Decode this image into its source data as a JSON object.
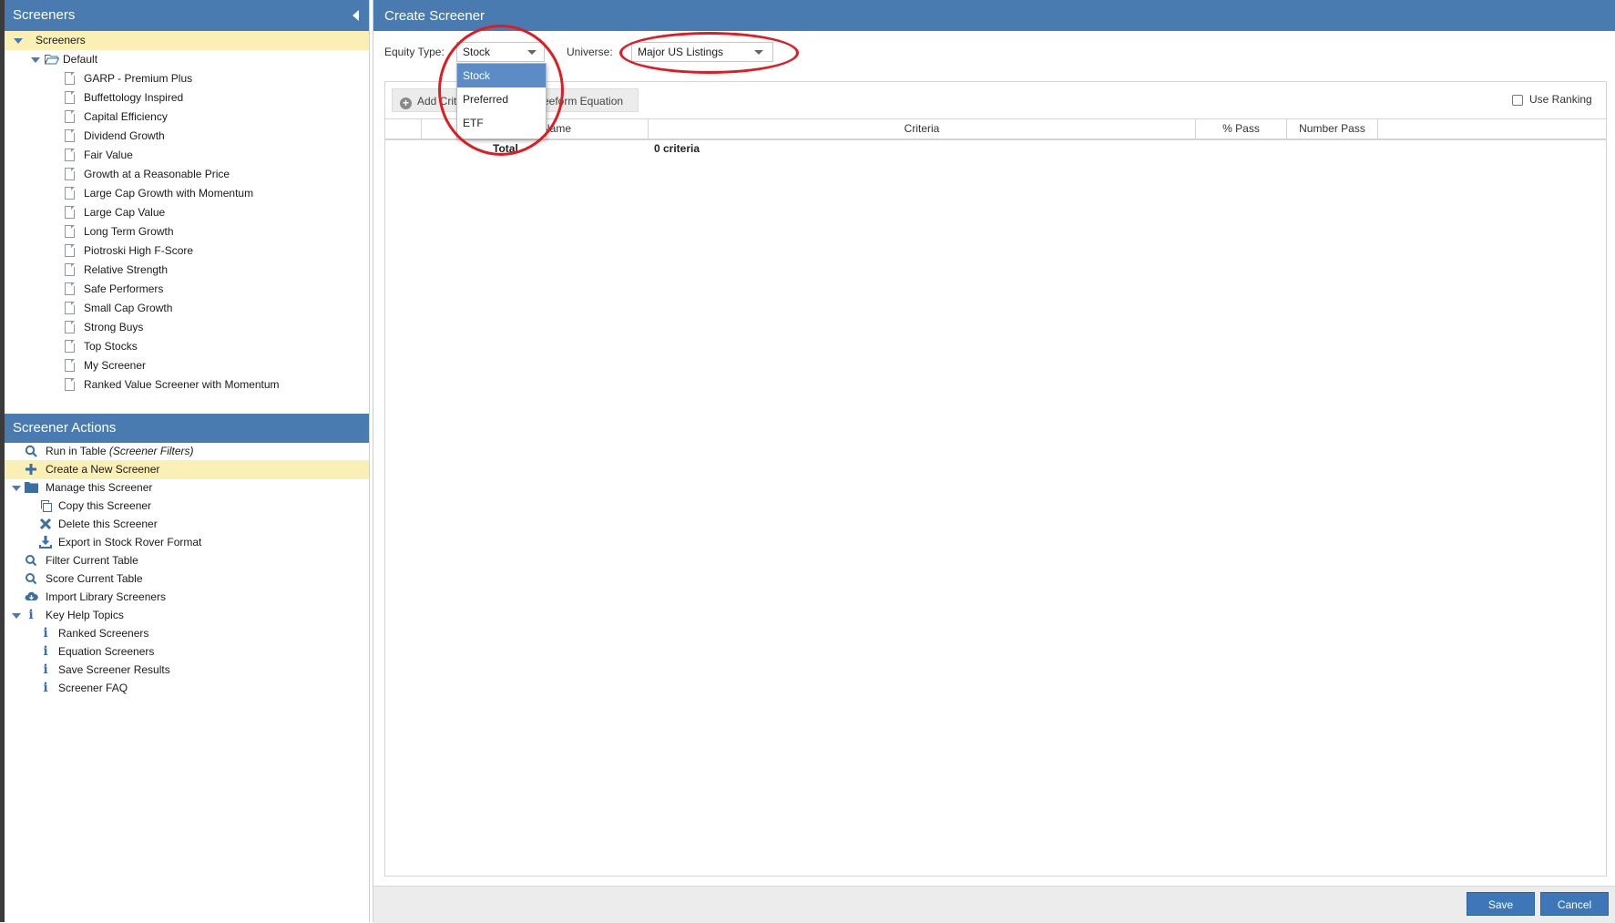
{
  "sidebar": {
    "screeners_header": "Screeners",
    "tree_root": "Screeners",
    "folder": "Default",
    "items": [
      "GARP - Premium Plus",
      "Buffettology Inspired",
      "Capital Efficiency",
      "Dividend Growth",
      "Fair Value",
      "Growth at a Reasonable Price",
      "Large Cap Growth with Momentum",
      "Large Cap Value",
      "Long Term Growth",
      "Piotroski High F-Score",
      "Relative Strength",
      "Safe Performers",
      "Small Cap Growth",
      "Strong Buys",
      "Top Stocks",
      "My Screener",
      "Ranked Value Screener with Momentum"
    ],
    "actions_header": "Screener Actions",
    "actions": {
      "run_in_table": "Run in Table",
      "run_in_table_note": "(Screener Filters)",
      "create_new": "Create a New Screener",
      "manage": "Manage this Screener",
      "copy": "Copy this Screener",
      "delete": "Delete this Screener",
      "export": "Export in Stock Rover Format",
      "filter": "Filter Current Table",
      "score": "Score Current Table",
      "import": "Import Library Screeners",
      "help": "Key Help Topics",
      "help_ranked": "Ranked Screeners",
      "help_equation": "Equation Screeners",
      "help_save": "Save Screener Results",
      "help_faq": "Screener FAQ"
    }
  },
  "main": {
    "title": "Create Screener",
    "equity_type_label": "Equity Type:",
    "equity_type_value": "Stock",
    "equity_options": [
      "Stock",
      "Preferred",
      "ETF"
    ],
    "universe_label": "Universe:",
    "universe_value": "Major US Listings",
    "add_criteria_label": "Add Crit",
    "freeform_label": "reeform Equation",
    "use_ranking_label": "Use Ranking",
    "columns": {
      "name": "Name",
      "criteria": "Criteria",
      "pct_pass": "% Pass",
      "number_pass": "Number Pass"
    },
    "total_label": "Total",
    "total_criteria": "0 criteria",
    "save_label": "Save",
    "cancel_label": "Cancel"
  },
  "colors": {
    "header_blue": "#4a7bb0",
    "selection_yellow": "#faefb4",
    "annotation_red": "#e01b22",
    "button_blue": "#3d77b7"
  }
}
